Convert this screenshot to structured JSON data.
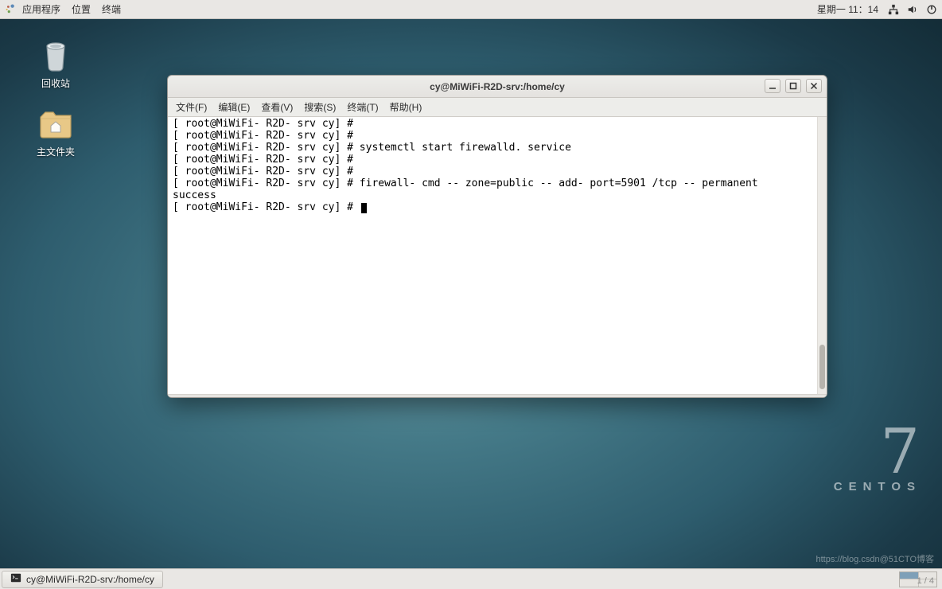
{
  "topPanel": {
    "menus": [
      "应用程序",
      "位置",
      "终端"
    ],
    "clock": "星期一 11：14"
  },
  "desktop": {
    "trash_label": "回收站",
    "home_label": "主文件夹"
  },
  "branding": {
    "version": "7",
    "name": "CENTOS"
  },
  "window": {
    "title": "cy@MiWiFi-R2D-srv:/home/cy",
    "menus": [
      "文件(F)",
      "编辑(E)",
      "查看(V)",
      "搜索(S)",
      "终端(T)",
      "帮助(H)"
    ],
    "terminal_lines": [
      "[ root@MiWiFi- R2D- srv cy] #",
      "[ root@MiWiFi- R2D- srv cy] #",
      "[ root@MiWiFi- R2D- srv cy] # systemctl start firewalld. service",
      "[ root@MiWiFi- R2D- srv cy] #",
      "[ root@MiWiFi- R2D- srv cy] #",
      "[ root@MiWiFi- R2D- srv cy] # firewall- cmd -- zone=public -- add- port=5901 /tcp -- permanent",
      "success",
      "[ root@MiWiFi- R2D- srv cy] # "
    ]
  },
  "taskbar": {
    "task_label": "cy@MiWiFi-R2D-srv:/home/cy"
  },
  "watermark": "https://blog.csdn@51CTO博客",
  "pager": "1 / 4"
}
